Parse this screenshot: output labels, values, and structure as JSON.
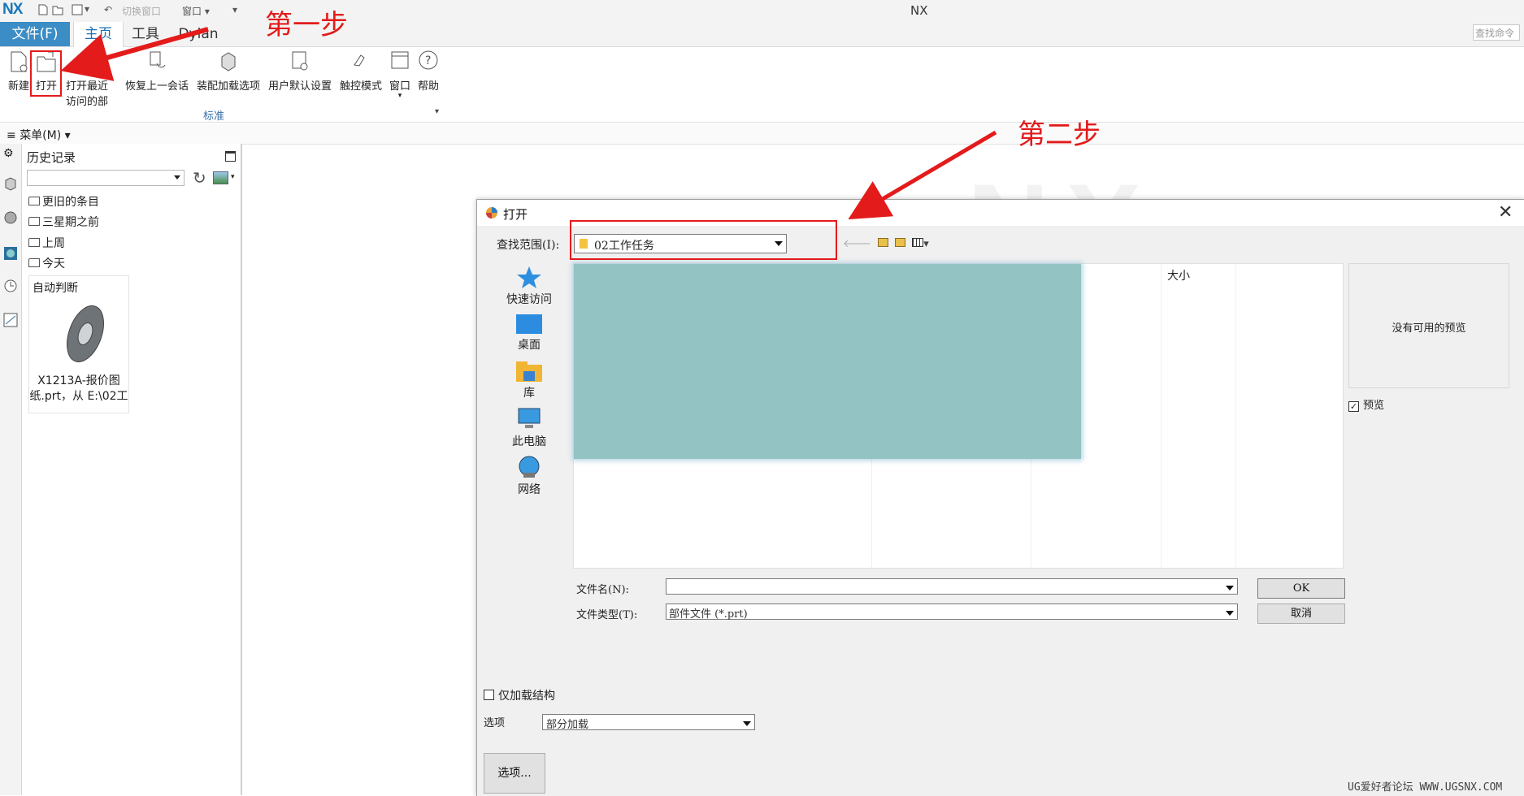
{
  "titlebar": {
    "logo": "NX",
    "switch_window": "切换窗口",
    "window_menu": "窗口",
    "app_title": "NX"
  },
  "tabs": {
    "file": "文件(F)",
    "home": "主页",
    "tools": "工具",
    "dylan": "Dylan",
    "search_placeholder": "查找命令"
  },
  "ribbon": {
    "new": "新建",
    "open": "打开",
    "recent_line1": "打开最近",
    "recent_line2": "访问的部",
    "restore": "恢复上一会话",
    "assembly": "装配加载选项",
    "user_defaults": "用户默认设置",
    "touch": "触控模式",
    "window": "窗口",
    "help": "帮助",
    "group_label": "标准"
  },
  "menubar": {
    "label": "菜单(M)"
  },
  "history": {
    "title": "历史记录",
    "folders": [
      "更旧的条目",
      "三星期之前",
      "上周",
      "今天"
    ],
    "thumb_title": "自动判断",
    "thumb_name_line1": "X1213A-报价图",
    "thumb_name_line2": "纸.prt，从 E:\\02工"
  },
  "dialog": {
    "title": "打开",
    "lookin_label": "查找范围(I):",
    "lookin_value": "02工作任务",
    "places": [
      "快速访问",
      "桌面",
      "库",
      "此电脑",
      "网络"
    ],
    "col_size": "大小",
    "no_preview": "没有可用的预览",
    "preview_label": "预览",
    "preview_checked": true,
    "filename_label": "文件名(N):",
    "filename_value": "",
    "filetype_label": "文件类型(T):",
    "filetype_value": "部件文件 (*.prt)",
    "ok": "OK",
    "cancel": "取消",
    "load_structure_label": "仅加载结构",
    "options_label": "选项",
    "load_option_value": "部分加载",
    "options_button": "选项..."
  },
  "annotations": {
    "step1": "第一步",
    "step2": "第二步",
    "color": "#e31b1b"
  },
  "footer": {
    "site_mark": "UG爱好者论坛 WWW.UGSNX.COM"
  },
  "colors": {
    "accent": "#3c8dc5",
    "tab_active_text": "#1d6fb3",
    "blurred_region": "#93c3c3"
  }
}
